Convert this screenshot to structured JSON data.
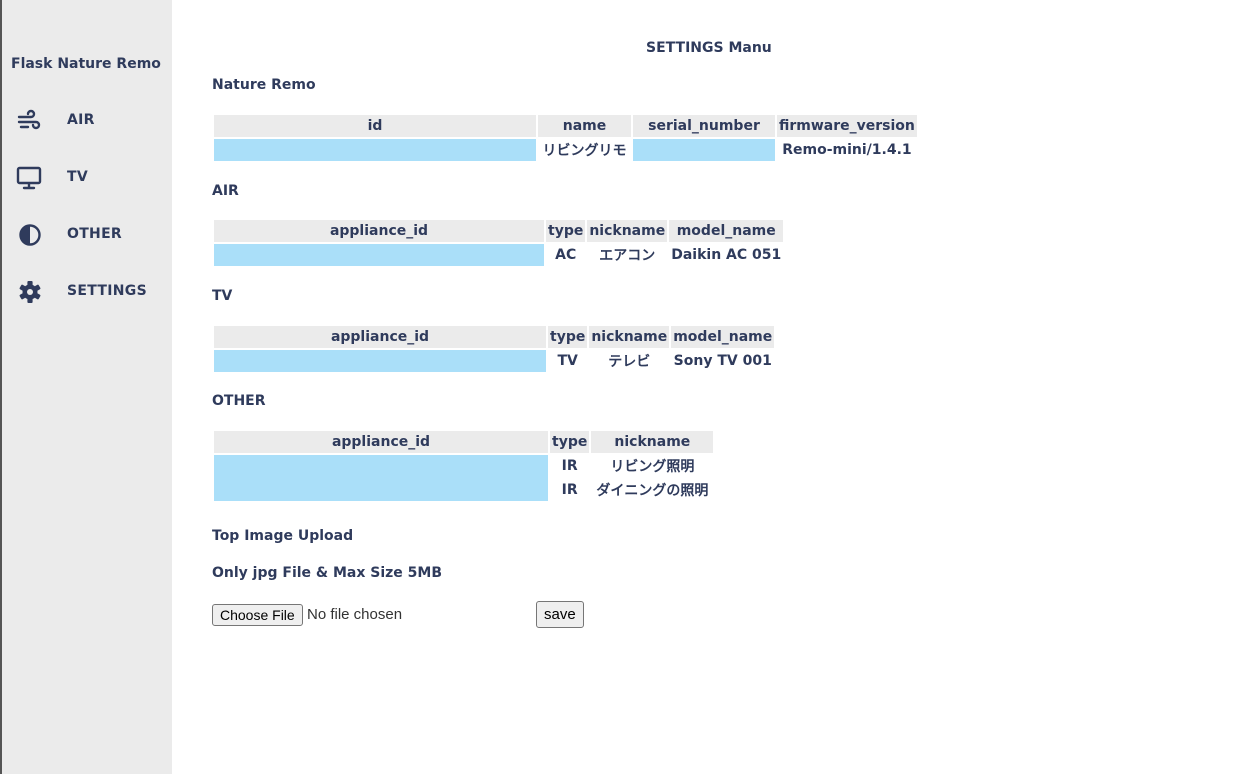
{
  "sidebar": {
    "app_title": "Flask Nature Remo",
    "items": [
      {
        "label": "AIR",
        "icon": "wind-icon"
      },
      {
        "label": "TV",
        "icon": "monitor-icon"
      },
      {
        "label": "OTHER",
        "icon": "contrast-icon"
      },
      {
        "label": "SETTINGS",
        "icon": "gear-icon"
      }
    ]
  },
  "page": {
    "title": "SETTINGS Manu"
  },
  "nature_remo": {
    "title": "Nature Remo",
    "columns": [
      "id",
      "name",
      "serial_number",
      "firmware_version"
    ],
    "rows": [
      {
        "id": "",
        "name": "リビングリモ",
        "serial_number": "",
        "firmware_version": "Remo-mini/1.4.1"
      }
    ]
  },
  "air": {
    "title": "AIR",
    "columns": [
      "appliance_id",
      "type",
      "nickname",
      "model_name"
    ],
    "rows": [
      {
        "appliance_id": "",
        "type": "AC",
        "nickname": "エアコン",
        "model_name": "Daikin AC 051"
      }
    ]
  },
  "tv": {
    "title": "TV",
    "columns": [
      "appliance_id",
      "type",
      "nickname",
      "model_name"
    ],
    "rows": [
      {
        "appliance_id": "",
        "type": "TV",
        "nickname": "テレビ",
        "model_name": "Sony TV 001"
      }
    ]
  },
  "other": {
    "title": "OTHER",
    "columns": [
      "appliance_id",
      "type",
      "nickname"
    ],
    "rows": [
      {
        "appliance_id": "",
        "type": "IR",
        "nickname": "リビング照明"
      },
      {
        "appliance_id": "",
        "type": "IR",
        "nickname": "ダイニングの照明"
      }
    ]
  },
  "upload": {
    "title": "Top Image Upload",
    "note": "Only jpg File & Max Size 5MB",
    "choose_label": "Choose File",
    "status": "No file chosen",
    "save_label": "save"
  },
  "colors": {
    "text": "#2f3b5c",
    "sidebar_bg": "#ebebeb",
    "mask": "#aadff9",
    "header_bg": "#ebebeb"
  }
}
